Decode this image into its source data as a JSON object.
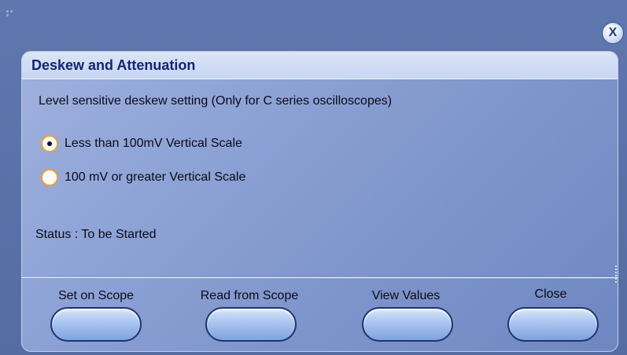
{
  "dialog": {
    "title": "Deskew and Attenuation",
    "description": "Level sensitive deskew setting (Only for C series oscilloscopes)",
    "close_icon_glyph": "X"
  },
  "options": [
    {
      "label": "Less than 100mV Vertical Scale",
      "selected": true
    },
    {
      "label": "100 mV or greater Vertical Scale",
      "selected": false
    }
  ],
  "status": "Status : To be Started",
  "buttons": [
    {
      "label": "Set on Scope"
    },
    {
      "label": "Read from Scope"
    },
    {
      "label": "View Values"
    },
    {
      "label": "Close"
    }
  ],
  "colors": {
    "title_text": "#14237a",
    "radio_border": "#f0a030",
    "button_border": "#1e3470"
  }
}
